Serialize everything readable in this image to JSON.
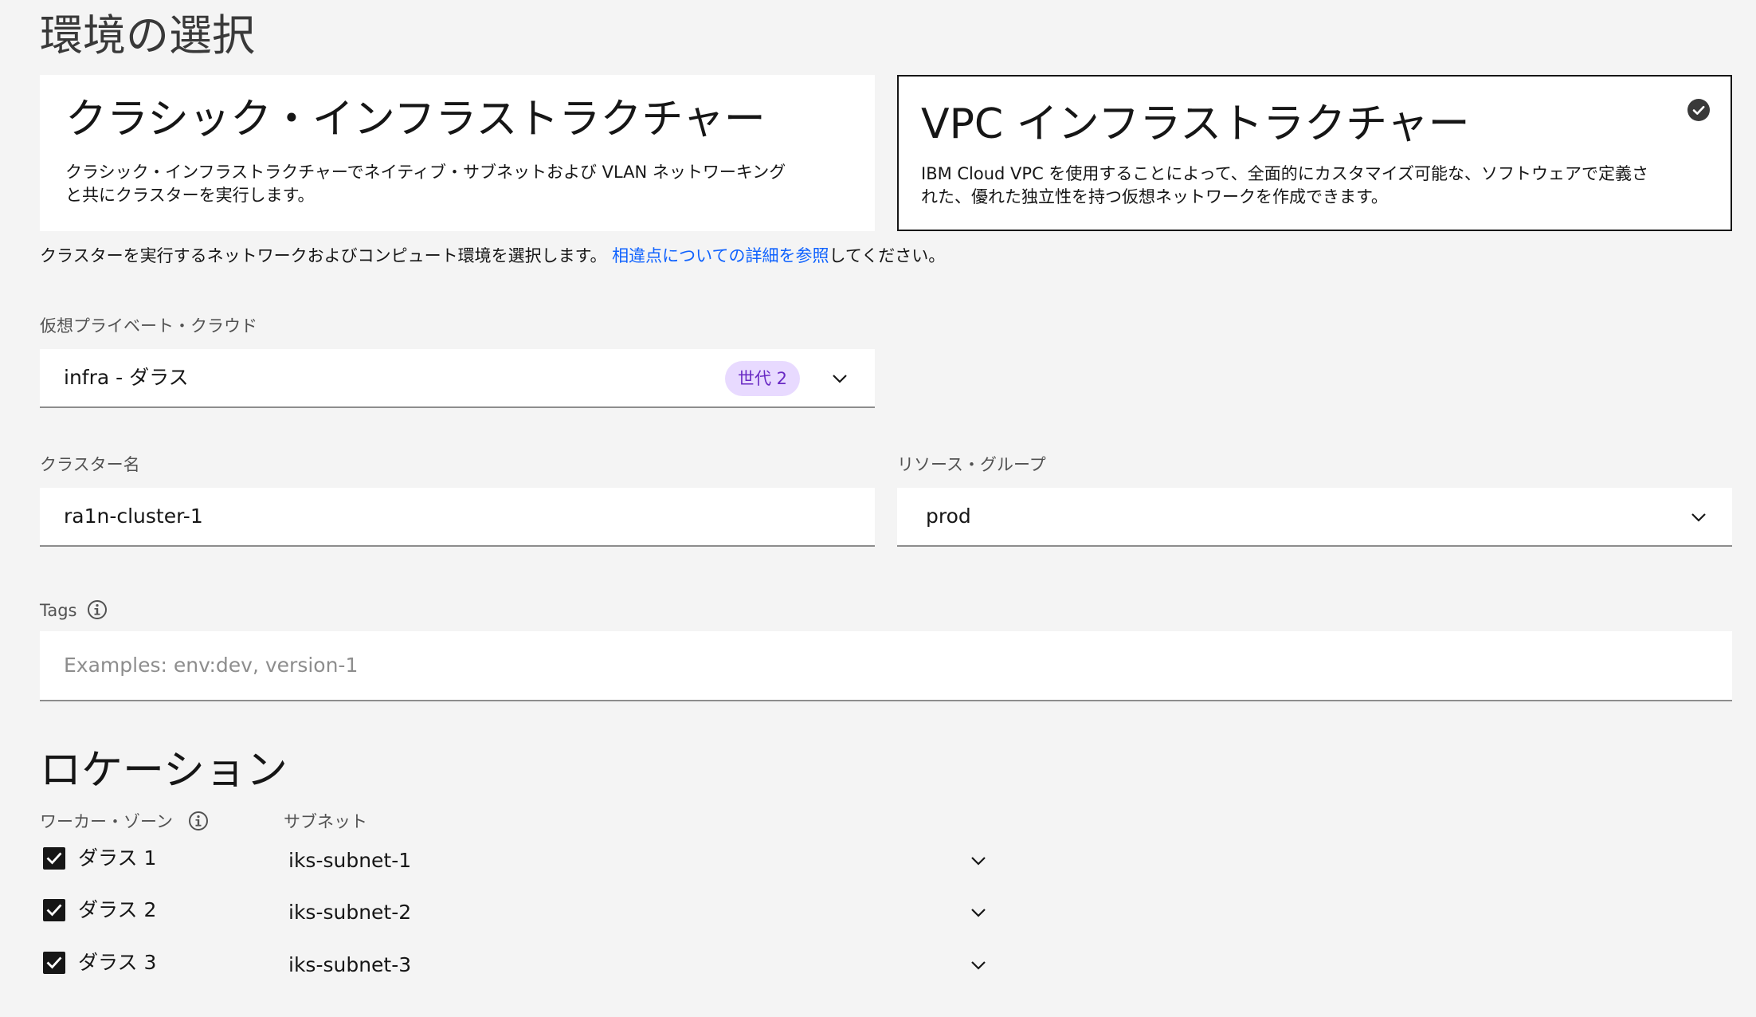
{
  "page": {
    "title": "環境の選択"
  },
  "tiles": {
    "classic": {
      "title": "クラシック・インフラストラクチャー",
      "description": "クラシック・インフラストラクチャーでネイティブ・サブネットおよび VLAN ネットワーキングと共にクラスターを実行します。",
      "selected": false
    },
    "vpc": {
      "title": "VPC インフラストラクチャー",
      "description": "IBM Cloud VPC を使用することによって、全面的にカスタマイズ可能な、ソフトウェアで定義された、優れた独立性を持つ仮想ネットワークを作成できます。",
      "selected": true
    }
  },
  "helper": {
    "text": "クラスターを実行するネットワークおよびコンピュート環境を選択します。 ",
    "link": "相違点についての詳細を参照",
    "suffix": "してください。"
  },
  "vpc_field": {
    "label": "仮想プライベート・クラウド",
    "value": "infra - ダラス",
    "badge": "世代 2"
  },
  "cluster_name": {
    "label": "クラスター名",
    "value": "ra1n-cluster-1"
  },
  "resource_group": {
    "label": "リソース・グループ",
    "value": "prod"
  },
  "tags": {
    "label": "Tags",
    "placeholder": "Examples: env:dev, version-1"
  },
  "location": {
    "title": "ロケーション",
    "zone_header": "ワーカー・ゾーン",
    "subnet_header": "サブネット",
    "zones": [
      {
        "label": "ダラス 1",
        "checked": true,
        "subnet": "iks-subnet-1"
      },
      {
        "label": "ダラス 2",
        "checked": true,
        "subnet": "iks-subnet-2"
      },
      {
        "label": "ダラス 3",
        "checked": true,
        "subnet": "iks-subnet-3"
      }
    ]
  },
  "colors": {
    "background": "#f4f4f4",
    "field": "#ffffff",
    "link": "#0f62fe",
    "badge_bg": "#e8daff",
    "badge_text": "#6929c4",
    "selected_border": "#161616"
  },
  "icons": {
    "selected": "checkmark-filled-icon",
    "dropdown": "chevron-down-icon",
    "info": "information-icon",
    "checkbox": "checkbox-checked-icon"
  }
}
